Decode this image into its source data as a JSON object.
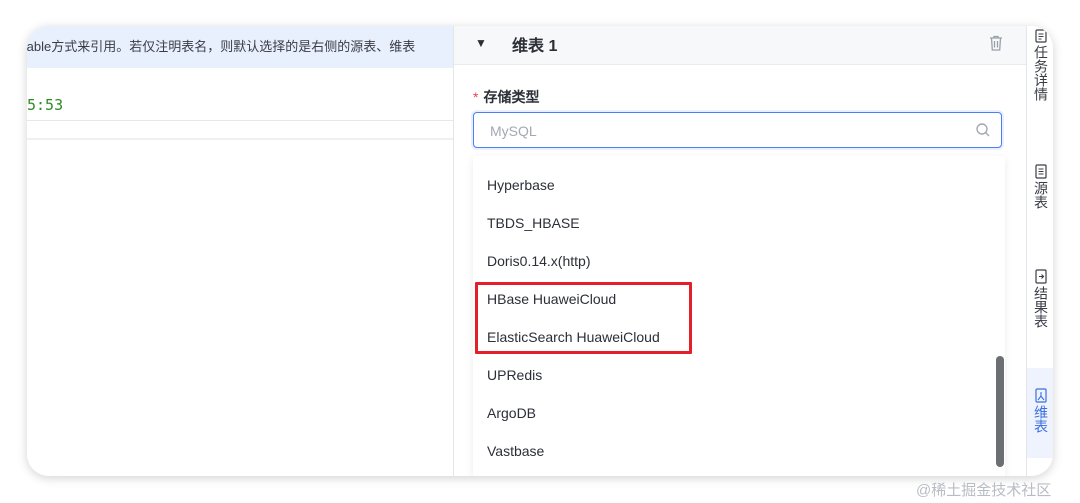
{
  "left_pane": {
    "banner_text": "table方式来引用。若仅注明表名，则默认选择的是右侧的源表、维表",
    "time_text": "5:53"
  },
  "panel": {
    "title": "维表 1",
    "storage_label": "存储类型",
    "required_mark": "*",
    "search_placeholder": "MySQL",
    "options": [
      {
        "label": "Hyperbase"
      },
      {
        "label": "TBDS_HBASE"
      },
      {
        "label": "Doris0.14.x(http)"
      },
      {
        "label": "HBase HuaweiCloud"
      },
      {
        "label": "ElasticSearch HuaweiCloud"
      },
      {
        "label": "UPRedis"
      },
      {
        "label": "ArgoDB"
      },
      {
        "label": "Vastbase"
      }
    ],
    "highlighted_options": [
      "HBase HuaweiCloud",
      "ElasticSearch HuaweiCloud"
    ]
  },
  "right_rail": {
    "items": [
      {
        "label": "任务详情",
        "icon": "task-details-icon"
      },
      {
        "label": "源表",
        "icon": "source-table-icon"
      },
      {
        "label": "结果表",
        "icon": "result-table-icon"
      },
      {
        "label": "维表",
        "icon": "dimension-table-icon",
        "active": true
      }
    ]
  },
  "watermark": "@稀土掘金技术社区",
  "colors": {
    "accent": "#4a7ff5",
    "highlight_border": "#e3202a",
    "banner_bg": "#e8effd",
    "time_green": "#2f8a26"
  }
}
